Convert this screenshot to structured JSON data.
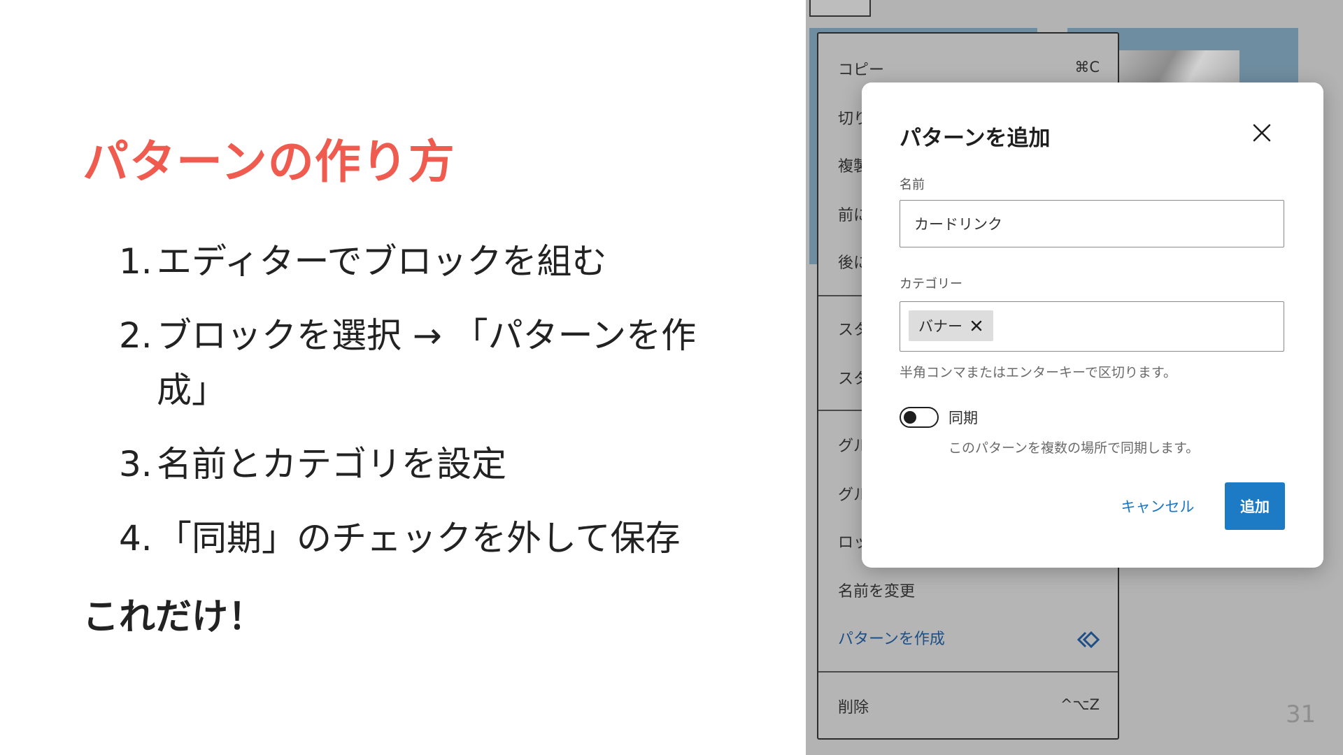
{
  "slide": {
    "title": "パターンの作り方",
    "steps": [
      {
        "num": "1.",
        "text": "エディターでブロックを組む"
      },
      {
        "num": "2.",
        "text": "ブロックを選択 → 「パターンを作成」"
      },
      {
        "num": "3.",
        "text": "名前とカテゴリを設定"
      },
      {
        "num": "4.",
        "text": "「同期」のチェックを外して保存"
      }
    ],
    "conclusion": "これだけ！",
    "page_number": "31"
  },
  "context_menu": {
    "items": [
      {
        "label": "コピー",
        "shortcut": "⌘C"
      },
      {
        "label": "切り"
      },
      {
        "label": "複製"
      },
      {
        "label": "前に"
      },
      {
        "label": "後に"
      },
      {
        "label": "スタ"
      },
      {
        "label": "スタ"
      },
      {
        "label": "グル"
      },
      {
        "label": "グル"
      },
      {
        "label": "ロッ"
      },
      {
        "label": "名前を変更"
      },
      {
        "label": "パターンを作成"
      },
      {
        "label": "削除",
        "shortcut": "^⌥Z"
      }
    ]
  },
  "modal": {
    "title": "パターンを追加",
    "name_label": "名前",
    "name_value": "カードリンク",
    "category_label": "カテゴリー",
    "category_chip": "バナー",
    "category_help": "半角コンマまたはエンターキーで区切ります。",
    "sync_label": "同期",
    "sync_help": "このパターンを複数の場所で同期します。",
    "sync_enabled": false,
    "cancel_label": "キャンセル",
    "add_label": "追加"
  },
  "colors": {
    "title_red": "#ef5b4e",
    "primary_blue": "#1d7bc6",
    "link_blue": "#1a75c2"
  }
}
